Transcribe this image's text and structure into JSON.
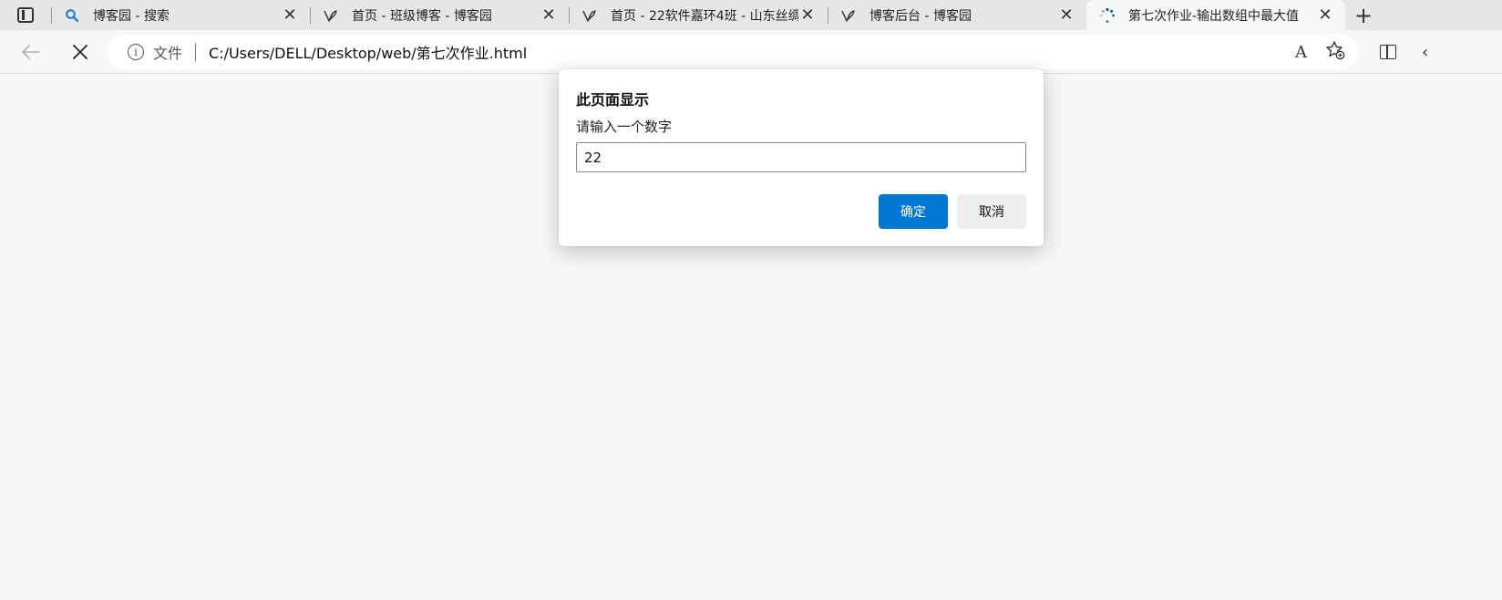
{
  "tabs": [
    {
      "title": "博客园 - 搜索",
      "icon": "search-favicon-icon",
      "active": false
    },
    {
      "title": "首页 - 班级博客 - 博客园",
      "icon": "cnblogs-favicon-icon",
      "active": false
    },
    {
      "title": "首页 - 22软件嘉环4班 - 山东丝绸",
      "icon": "cnblogs-favicon-icon",
      "active": false
    },
    {
      "title": "博客后台 - 博客园",
      "icon": "cnblogs-favicon-icon",
      "active": false
    },
    {
      "title": "第七次作业-输出数组中最大值",
      "icon": "loading-spinner-icon",
      "active": true
    }
  ],
  "toolbar": {
    "site_label": "文件",
    "url": "C:/Users/DELL/Desktop/web/第七次作业.html",
    "read_aloud_glyph": "A",
    "more_glyph": "‹"
  },
  "dialog": {
    "title": "此页面显示",
    "message": "请输入一个数字",
    "input_value": "22",
    "ok_label": "确定",
    "cancel_label": "取消"
  },
  "colors": {
    "accent": "#0078d4",
    "page_background": "#f7f7f7",
    "tabstrip_background": "#e7e7e7"
  }
}
